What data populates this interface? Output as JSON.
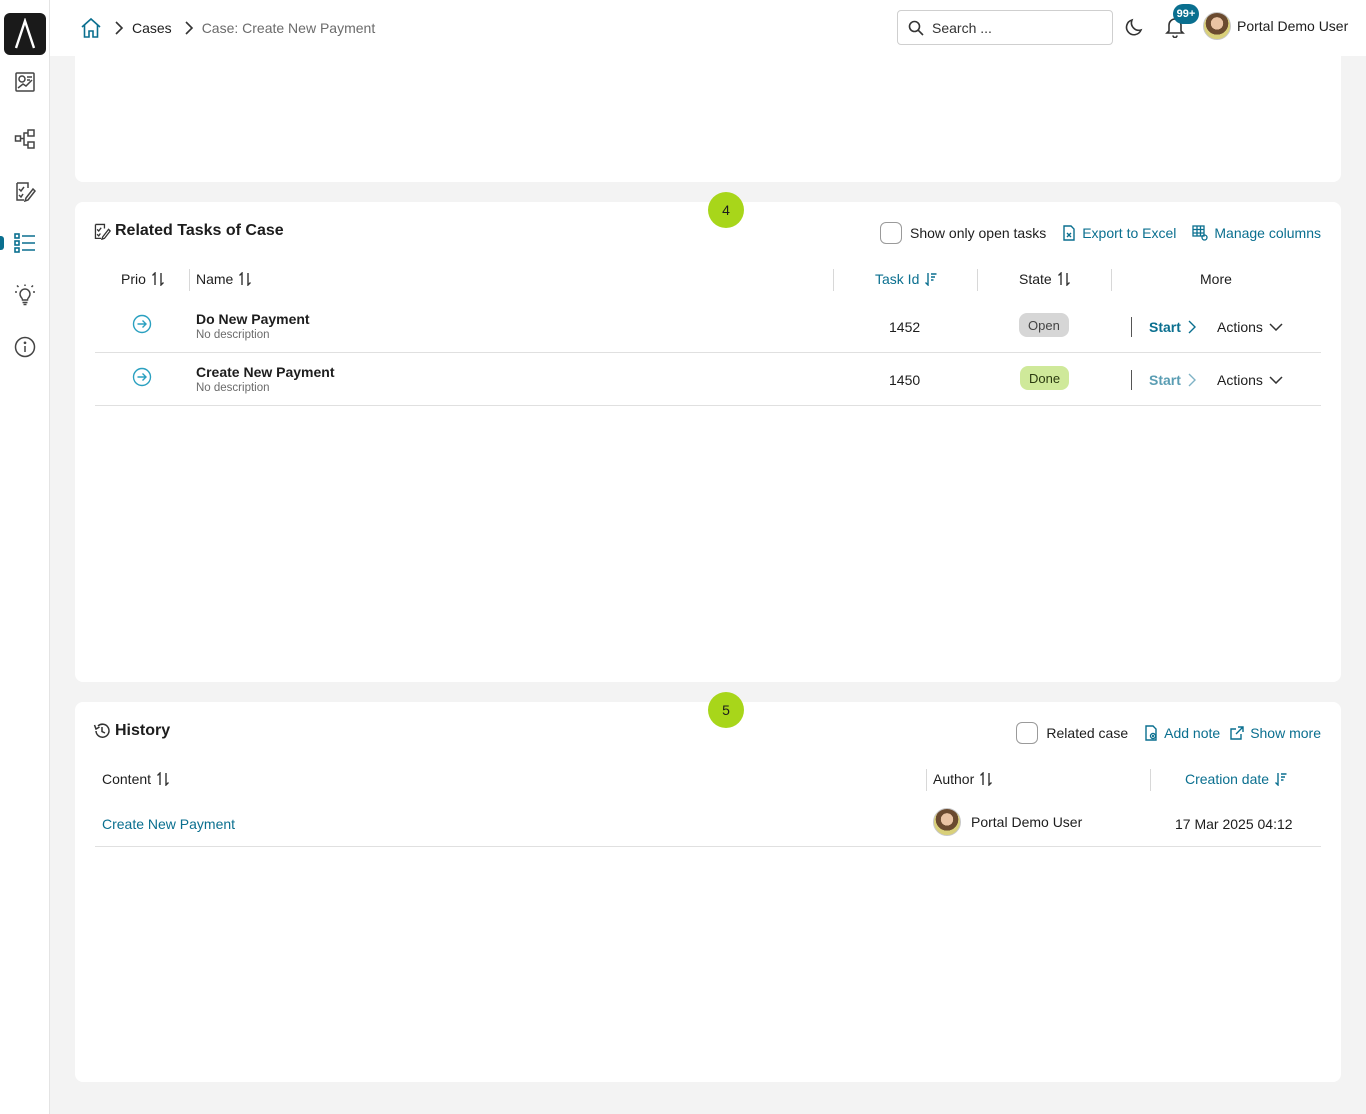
{
  "breadcrumb": {
    "home_icon": "home-icon",
    "items": [
      "Cases",
      "Case: Create New Payment"
    ]
  },
  "header": {
    "search_placeholder": "Search ...",
    "notification_count": "99+",
    "user_name": "Portal Demo User"
  },
  "sidebar": {
    "items": [
      {
        "icon": "dashboard-icon"
      },
      {
        "icon": "processes-icon"
      },
      {
        "icon": "tasks-icon"
      },
      {
        "icon": "cases-icon",
        "active": true
      },
      {
        "icon": "statistics-icon"
      },
      {
        "icon": "info-icon"
      }
    ]
  },
  "related_tasks": {
    "step_number": "4",
    "title": "Related Tasks of Case",
    "show_open_label": "Show only open tasks",
    "export_label": "Export to Excel",
    "manage_columns_label": "Manage columns",
    "columns": {
      "prio": "Prio",
      "name": "Name",
      "task_id": "Task Id",
      "state": "State",
      "more": "More"
    },
    "rows": [
      {
        "name": "Do New Payment",
        "description": "No description",
        "task_id": "1452",
        "state": "Open",
        "start": "Start",
        "actions": "Actions"
      },
      {
        "name": "Create New Payment",
        "description": "No description",
        "task_id": "1450",
        "state": "Done",
        "start": "Start",
        "actions": "Actions"
      }
    ]
  },
  "history": {
    "step_number": "5",
    "title": "History",
    "related_case_label": "Related case",
    "add_note_label": "Add note",
    "show_more_label": "Show more",
    "columns": {
      "content": "Content",
      "author": "Author",
      "creation_date": "Creation date"
    },
    "rows": [
      {
        "content": "Create New Payment",
        "author": "Portal Demo User",
        "creation_date": "17 Mar 2025 04:12"
      }
    ]
  },
  "colors": {
    "accent": "#0a6f8f",
    "step_badge": "#a8d61a",
    "state_open": "#d6d6d6",
    "state_done": "#cfe99a"
  }
}
